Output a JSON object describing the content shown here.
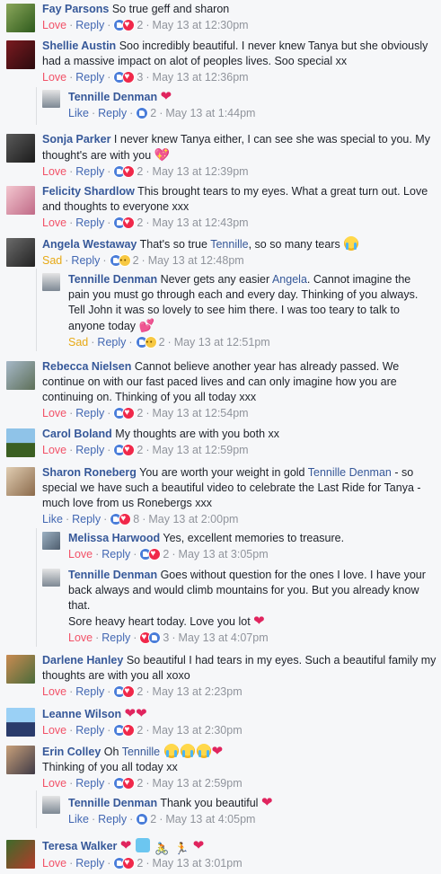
{
  "comments": [
    {
      "name": "Fay Parsons",
      "text": "So true geff and sharon",
      "react": "Love",
      "reply": "Reply",
      "count": "2",
      "time": "May 13 at 12:30pm"
    },
    {
      "name": "Shellie Austin",
      "text": "Soo incredibly beautiful. I never knew Tanya but she obviously had a massive impact on alot of peoples lives. Soo special xx",
      "react": "Love",
      "reply": "Reply",
      "count": "3",
      "time": "May 13 at 12:36pm"
    },
    {
      "name": "Tennille Denman",
      "text": "",
      "react": "Like",
      "reply": "Reply",
      "count": "2",
      "time": "May 13 at 1:44pm"
    },
    {
      "name": "Sonja Parker",
      "text": "I never knew Tanya either, I can see she was special to you. My thought's are with you",
      "react": "Love",
      "reply": "Reply",
      "count": "2",
      "time": "May 13 at 12:39pm"
    },
    {
      "name": "Felicity Shardlow",
      "text": "This brought tears to my eyes. What a great turn out. Love and thoughts to everyone xxx",
      "react": "Love",
      "reply": "Reply",
      "count": "2",
      "time": "May 13 at 12:43pm"
    },
    {
      "name": "Angela Westaway",
      "text_a": "That's so true",
      "mention": "Tennille",
      "text_b": ", so so many tears",
      "react": "Sad",
      "reply": "Reply",
      "count": "2",
      "time": "May 13 at 12:48pm"
    },
    {
      "name": "Tennille Denman",
      "text_a": "Never gets any easier",
      "mention": "Angela",
      "text_b": ". Cannot imagine the pain you must go through each and every day. Thinking of you always.",
      "line2": "Tell John it was so lovely to see him there. I was too teary to talk to anyone today",
      "react": "Sad",
      "reply": "Reply",
      "count": "2",
      "time": "May 13 at 12:51pm"
    },
    {
      "name": "Rebecca Nielsen",
      "text": "Cannot believe another year has already passed. We continue on with our fast paced lives and can only imagine how you are continuing on. Thinking of you all today xxx",
      "react": "Love",
      "reply": "Reply",
      "count": "2",
      "time": "May 13 at 12:54pm"
    },
    {
      "name": "Carol Boland",
      "text": "My thoughts are with you both xx",
      "react": "Love",
      "reply": "Reply",
      "count": "2",
      "time": "May 13 at 12:59pm"
    },
    {
      "name": "Sharon Roneberg",
      "text_a": "You are worth your weight in gold",
      "mention": "Tennille Denman",
      "text_b": "- so special we have such a beautiful video to celebrate the Last Ride for Tanya - much love from us Ronebergs xxx",
      "react": "Like",
      "reply": "Reply",
      "count": "8",
      "time": "May 13 at 2:00pm"
    },
    {
      "name": "Melissa Harwood",
      "text": "Yes, excellent memories to treasure.",
      "react": "Love",
      "reply": "Reply",
      "count": "2",
      "time": "May 13 at 3:05pm"
    },
    {
      "name": "Tennille Denman",
      "text": "Goes without question for the ones I love. I have your back always and would climb mountains for you. But you already know that.",
      "line2": "Sore heavy heart today. Love you lot",
      "react": "Love",
      "reply": "Reply",
      "count": "3",
      "time": "May 13 at 4:07pm"
    },
    {
      "name": "Darlene Hanley",
      "text": "So beautiful I had tears in my eyes. Such a beautiful family my thoughts are with you all xoxo",
      "react": "Love",
      "reply": "Reply",
      "count": "2",
      "time": "May 13 at 2:23pm"
    },
    {
      "name": "Leanne Wilson",
      "text": "",
      "react": "Love",
      "reply": "Reply",
      "count": "2",
      "time": "May 13 at 2:30pm"
    },
    {
      "name": "Erin Colley",
      "text_a": "Oh",
      "mention": "Tennille",
      "line2": "Thinking of you all today xx",
      "react": "Love",
      "reply": "Reply",
      "count": "2",
      "time": "May 13 at 2:59pm"
    },
    {
      "name": "Tennille Denman",
      "text": "Thank you beautiful",
      "react": "Like",
      "reply": "Reply",
      "count": "2",
      "time": "May 13 at 4:05pm"
    },
    {
      "name": "Teresa Walker",
      "text": "",
      "react": "Love",
      "reply": "Reply",
      "count": "2",
      "time": "May 13 at 3:01pm"
    }
  ],
  "sep": "·",
  "colors": {
    "name": "#365899",
    "love": "#f25268",
    "like": "#4267b2",
    "sad": "#e7a915",
    "meta": "#90949c"
  }
}
